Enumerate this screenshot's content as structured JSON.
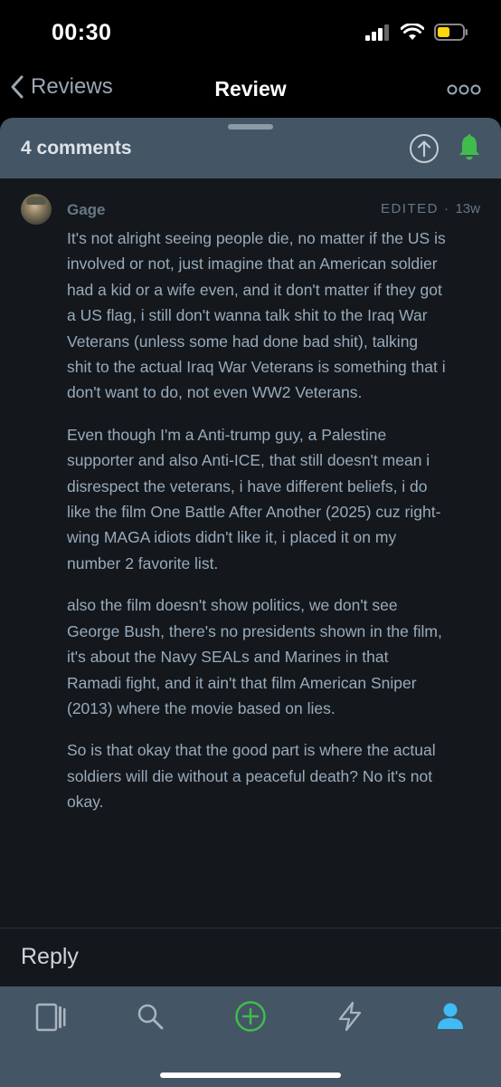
{
  "status_bar": {
    "time": "00:30"
  },
  "nav": {
    "back_label": "Reviews",
    "title": "Review"
  },
  "sheet": {
    "comments_count": "4 comments"
  },
  "comment": {
    "author": "Gage",
    "edited": "EDITED",
    "separator": "·",
    "ago": "13w",
    "paragraphs": [
      "It's not alright seeing people die, no matter if the US is involved or not, just imagine that an American soldier had a kid or a wife even, and it don't matter if they got a US flag, i still don't wanna talk shit to the Iraq War Veterans (unless some had done bad shit), talking shit to the actual Iraq War Veterans is something that i don't want to do, not even WW2 Veterans.",
      "Even though I'm a Anti-trump guy, a Palestine supporter and also Anti-ICE, that still doesn't mean i disrespect the veterans, i have different beliefs, i do like the film One Battle After Another (2025) cuz right-wing MAGA idiots didn't like it, i placed it on my number 2 favorite list.",
      "also the film doesn't show politics, we don't see George Bush, there's no presidents shown in the film, it's about the Navy SEALs and Marines in that Ramadi fight, and it ain't that film American Sniper (2013) where the movie based on lies.",
      "So is that okay that the good part is where the actual soldiers will die without a peaceful death? No it's not okay."
    ]
  },
  "reply": {
    "label": "Reply"
  },
  "colors": {
    "accent_green": "#40bc4c",
    "accent_blue": "#40bcf4",
    "header_bg": "#445566",
    "body_bg": "#14181c"
  },
  "icons": {
    "status": [
      "signal-icon",
      "wifi-icon",
      "battery-icon"
    ],
    "tabs": [
      "films-icon",
      "search-icon",
      "add-icon",
      "activity-icon",
      "profile-icon"
    ]
  }
}
